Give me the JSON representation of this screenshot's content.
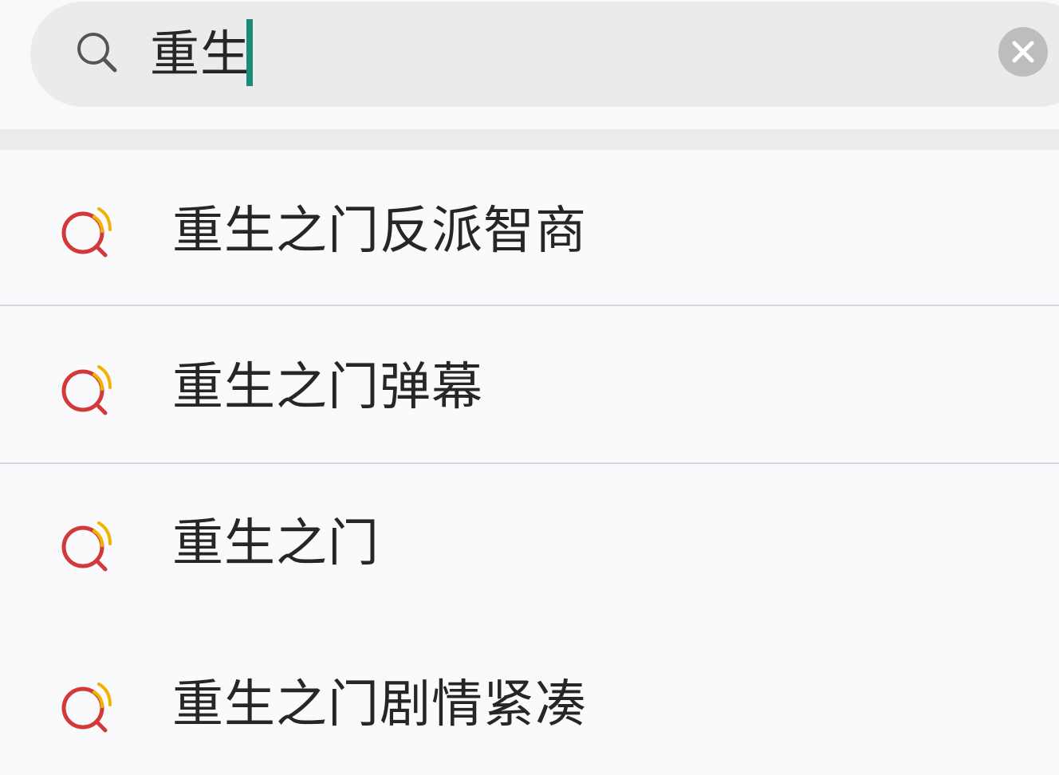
{
  "search": {
    "query": "重生"
  },
  "suggestions": [
    {
      "label": "重生之门反派智商"
    },
    {
      "label": "重生之门弹幕"
    },
    {
      "label": "重生之门"
    },
    {
      "label": "重生之门剧情紧凑"
    }
  ],
  "colors": {
    "caret": "#1f8a7a",
    "suggestion_icon_ring": "#d23a3a",
    "suggestion_icon_waves": "#f0b400",
    "clear_button": "#bdbdc0"
  },
  "icons": {
    "search": "search-icon",
    "clear": "close-icon",
    "suggestion": "hot-search-icon"
  }
}
